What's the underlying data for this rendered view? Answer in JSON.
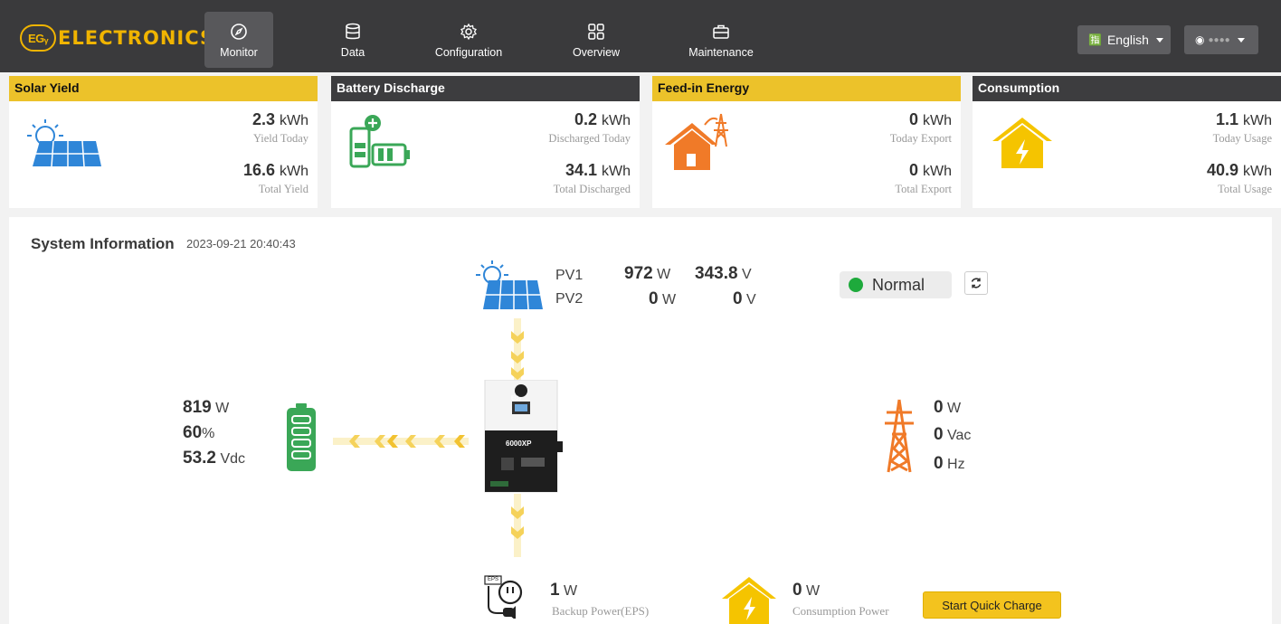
{
  "brand": {
    "badge": "EGᵧ",
    "name": "ELECTRONICS"
  },
  "nav": {
    "items": [
      {
        "label": "Monitor",
        "icon": "compass-icon",
        "active": true
      },
      {
        "label": "Data",
        "icon": "database-icon"
      },
      {
        "label": "Configuration",
        "icon": "gear-icon"
      },
      {
        "label": "Overview",
        "icon": "grid-icon"
      },
      {
        "label": "Maintenance",
        "icon": "briefcase-icon"
      }
    ],
    "language": "English",
    "user": "●●●●"
  },
  "cards": [
    {
      "title": "Solar Yield",
      "icon": "solar-panel-icon",
      "today_value": "2.3",
      "today_unit": "kWh",
      "today_label": "Yield Today",
      "total_value": "16.6",
      "total_unit": "kWh",
      "total_label": "Total Yield"
    },
    {
      "title": "Battery Discharge",
      "icon": "battery-charge-icon",
      "today_value": "0.2",
      "today_unit": "kWh",
      "today_label": "Discharged Today",
      "total_value": "34.1",
      "total_unit": "kWh",
      "total_label": "Total Discharged"
    },
    {
      "title": "Feed-in Energy",
      "icon": "house-grid-icon",
      "today_value": "0",
      "today_unit": "kWh",
      "today_label": "Today Export",
      "total_value": "0",
      "total_unit": "kWh",
      "total_label": "Total Export"
    },
    {
      "title": "Consumption",
      "icon": "house-power-icon",
      "today_value": "1.1",
      "today_unit": "kWh",
      "today_label": "Today Usage",
      "total_value": "40.9",
      "total_unit": "kWh",
      "total_label": "Total Usage"
    }
  ],
  "system": {
    "title": "System Information",
    "timestamp": "2023-09-21 20:40:43",
    "pv1": {
      "label": "PV1",
      "power": "972",
      "power_unit": "W",
      "voltage": "343.8",
      "voltage_unit": "V"
    },
    "pv2": {
      "label": "PV2",
      "power": "0",
      "power_unit": "W",
      "voltage": "0",
      "voltage_unit": "V"
    },
    "status": "Normal",
    "battery": {
      "power": "819",
      "power_unit": "W",
      "soc": "60",
      "soc_unit": "%",
      "voltage": "53.2",
      "voltage_unit": "Vdc"
    },
    "grid": {
      "power": "0",
      "power_unit": "W",
      "voltage": "0",
      "voltage_unit": "Vac",
      "freq": "0",
      "freq_unit": "Hz"
    },
    "inverter_model": "6000XP",
    "inverter_brand": "EGᵧ",
    "eps": {
      "icon_label": "EPS",
      "power": "1",
      "unit": "W",
      "label": "Backup Power(EPS)"
    },
    "consumption": {
      "power": "0",
      "unit": "W",
      "label": "Consumption Power"
    },
    "quick_charge_label": "Start Quick Charge"
  },
  "colors": {
    "nav_bg": "#3a3a3c",
    "accent_yellow": "#ecc22a",
    "battery_green": "#3aa757",
    "grid_orange": "#f07a28",
    "status_green": "#1eaa3c"
  }
}
